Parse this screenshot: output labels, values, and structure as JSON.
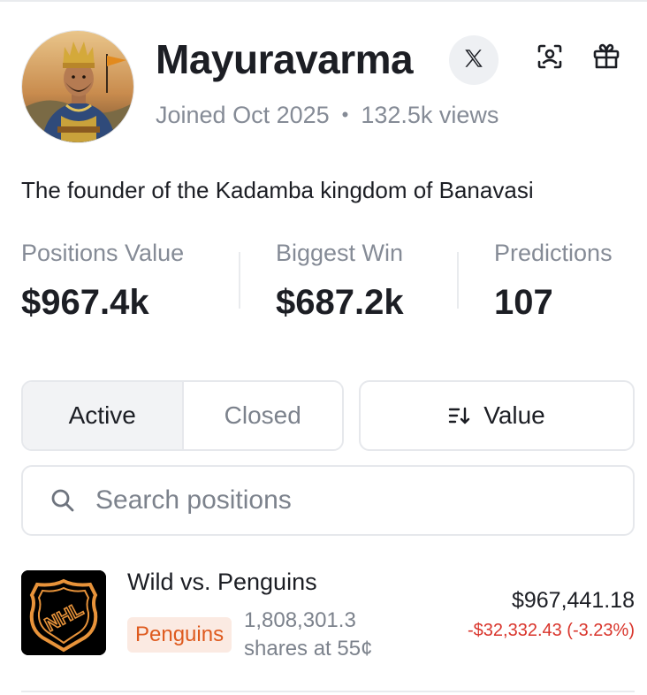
{
  "profile": {
    "username": "Mayuravarma",
    "joined": "Joined Oct 2025",
    "views": "132.5k views",
    "bio": "The founder of the Kadamba kingdom of Banavasi"
  },
  "header_icons": {
    "social": "x-logo-icon",
    "qr": "qr-scan-icon",
    "gift": "gift-icon"
  },
  "stats": [
    {
      "label": "Positions Value",
      "value": "$967.4k"
    },
    {
      "label": "Biggest Win",
      "value": "$687.2k"
    },
    {
      "label": "Predictions",
      "value": "107"
    }
  ],
  "tabs": [
    {
      "label": "Active",
      "selected": true
    },
    {
      "label": "Closed",
      "selected": false
    }
  ],
  "sort": {
    "label": "Value",
    "icon": "sort-descending-icon"
  },
  "search": {
    "placeholder": "Search positions",
    "value": ""
  },
  "positions": [
    {
      "title": "Wild vs. Penguins",
      "logo_text": "NHL",
      "outcome": "Penguins",
      "shares_line1": "1,808,301.3",
      "shares_line2": "shares at 55¢",
      "value": "$967,441.18",
      "pnl": "-$32,332.43 (-3.23%)"
    }
  ],
  "colors": {
    "text_primary": "#1c1e24",
    "text_secondary": "#858b96",
    "border": "#e6e8ec",
    "loss_red": "#d9342b",
    "outcome_orange": "#de5a1e",
    "outcome_badge_bg": "#fbeae2",
    "nhl_orange": "#e8933a"
  }
}
